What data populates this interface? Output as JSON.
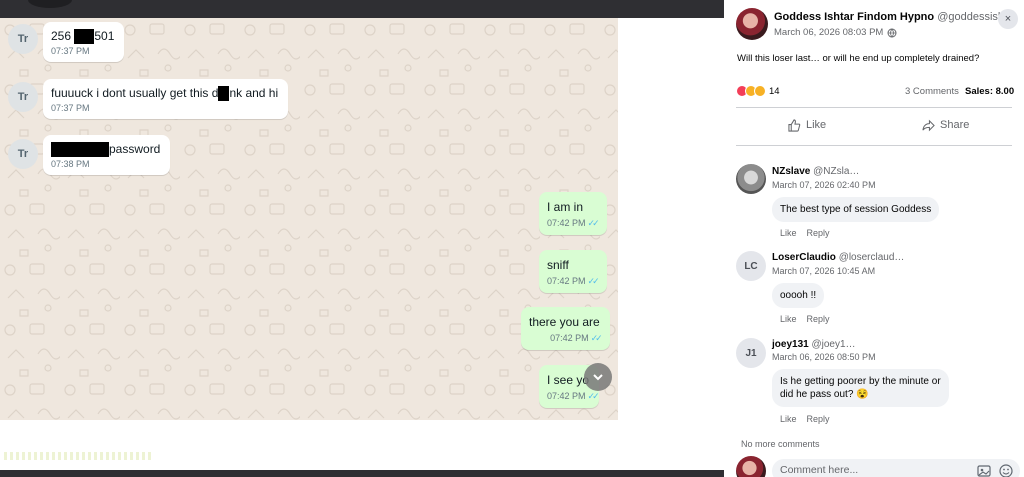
{
  "chat": {
    "incoming": [
      {
        "initials": "Tr",
        "text_prefix": "256 ",
        "text_suffix": "501",
        "time": "07:37 PM"
      },
      {
        "initials": "Tr",
        "text_prefix": "fuuuuck i dont usually get this d",
        "text_suffix": "nk and hi",
        "time": "07:37 PM"
      },
      {
        "initials": "Tr",
        "text_prefix": "",
        "text_suffix": "password",
        "time": "07:38 PM"
      }
    ],
    "outgoing": [
      {
        "text": "I am in",
        "time": "07:42 PM",
        "tick": "✓✓"
      },
      {
        "text": "sniff",
        "time": "07:42 PM",
        "tick": "✓✓"
      },
      {
        "text": "there you are",
        "time": "07:42 PM",
        "tick": "✓✓"
      },
      {
        "text": "I see yo",
        "time": "07:42 PM",
        "tick": "✓✓"
      }
    ],
    "scroll_icon": "chevron-down-icon",
    "bg_color": "#efe7de",
    "out_bubble_color": "#d9fdd3"
  },
  "post": {
    "author": "Goddess Ishtar Findom Hypno",
    "handle": "@goddessishtar",
    "date": "March 06, 2026 08:03 PM",
    "visibility_icon": "globe-icon",
    "text": "Will this loser last… or will he end up completely drained?",
    "reaction_count": "14",
    "comments_count": "3 Comments",
    "sales": "Sales: 8.00",
    "like_label": "Like",
    "share_label": "Share",
    "close_label": "×"
  },
  "comments": [
    {
      "name": "NZslave",
      "handle": "@NZsla…",
      "date": "March 07, 2026 02:40 PM",
      "text": "The best type of session Goddess",
      "initials": "",
      "like": "Like",
      "reply": "Reply"
    },
    {
      "name": "LoserClaudio",
      "handle": "@loserclaud…",
      "date": "March 07, 2026 10:45 AM",
      "text": "ooooh !!",
      "initials": "LC",
      "like": "Like",
      "reply": "Reply"
    },
    {
      "name": "joey131",
      "handle": "@joey1…",
      "date": "March 06, 2026 08:50 PM",
      "text_line1": "Is he getting poorer by the minute or",
      "text_line2": "did he pass out? 😵",
      "initials": "J1",
      "like": "Like",
      "reply": "Reply"
    }
  ],
  "no_more_comments": "No more comments",
  "comment_input": {
    "placeholder": "Comment here..."
  }
}
